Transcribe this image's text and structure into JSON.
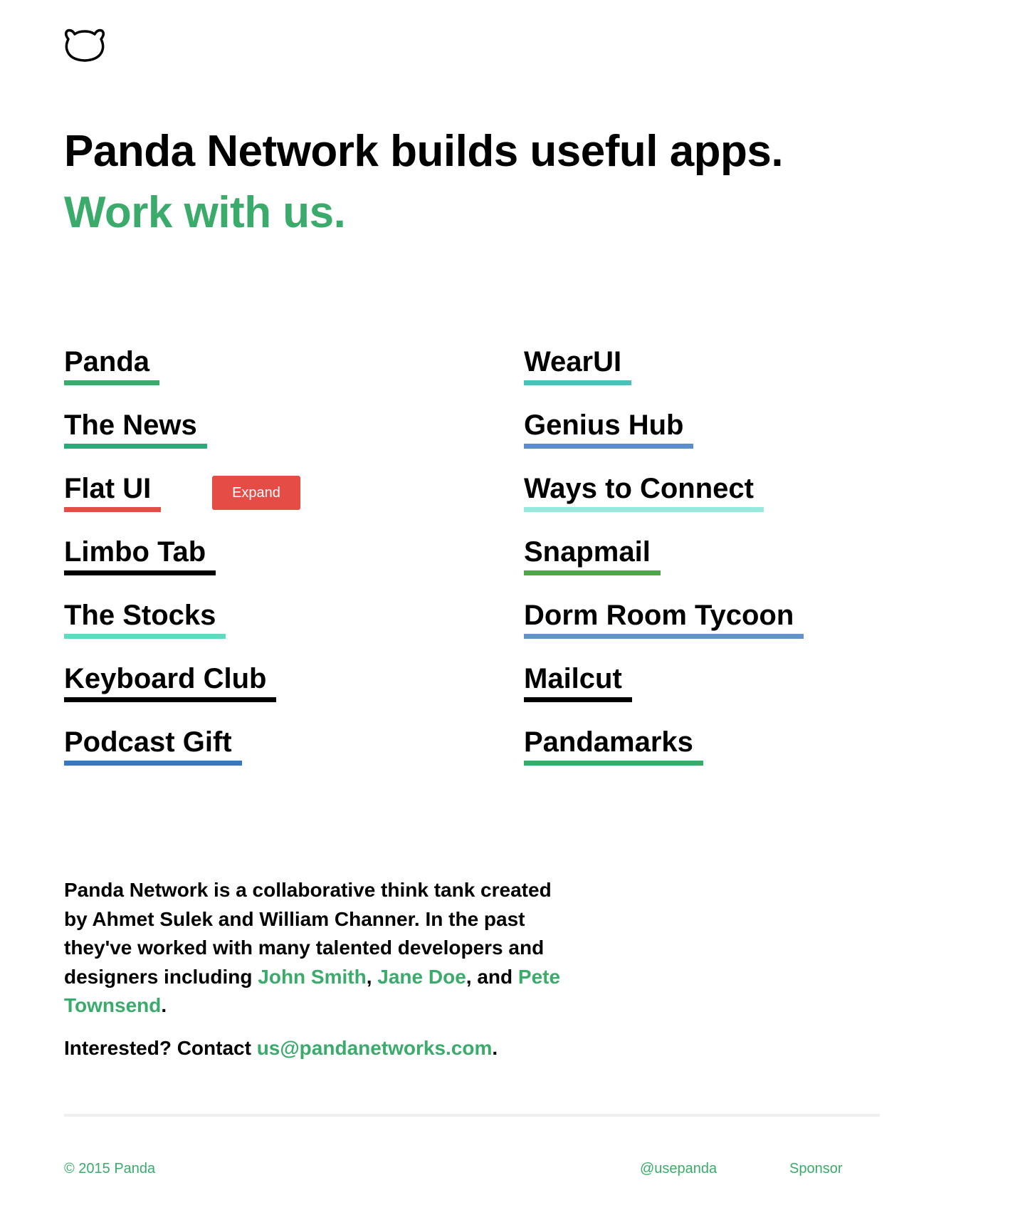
{
  "header": {
    "headline": "Panda Network builds useful apps.",
    "subheadline": "Work with us."
  },
  "projects": {
    "left": [
      {
        "name": "Panda",
        "color": "#3bab6b"
      },
      {
        "name": "The News",
        "color": "#27ab7a"
      },
      {
        "name": "Flat UI",
        "color": "#e44c45"
      },
      {
        "name": "Limbo Tab",
        "color": "#000000"
      },
      {
        "name": "The Stocks",
        "color": "#5ddcc2"
      },
      {
        "name": "Keyboard Club",
        "color": "#000000"
      },
      {
        "name": "Podcast Gift",
        "color": "#3a78be"
      }
    ],
    "right": [
      {
        "name": "WearUI",
        "color": "#4ac0ba"
      },
      {
        "name": "Genius Hub",
        "color": "#5b8ec8"
      },
      {
        "name": "Ways to Connect",
        "color": "#98e9de"
      },
      {
        "name": "Snapmail",
        "color": "#4ea54a"
      },
      {
        "name": "Dorm Room Tycoon",
        "color": "#6092cd"
      },
      {
        "name": "Mailcut",
        "color": "#000000"
      },
      {
        "name": "Pandamarks",
        "color": "#3bab6b"
      }
    ]
  },
  "expand_button": {
    "label": "Expand",
    "color": "#e44c45"
  },
  "about": {
    "text_before": "Panda Network is a collaborative think tank created by Ahmet Sulek and William Channer.  In the past they've worked with many talented developers and designers including ",
    "people": [
      "John Smith",
      "Jane Doe",
      "Pete Townsend"
    ],
    "sep1": ", ",
    "sep2": ", and ",
    "end": "."
  },
  "contact": {
    "prefix": "Interested? Contact ",
    "email": "us@pandanetworks.com",
    "suffix": "."
  },
  "footer": {
    "copyright": "© 2015 Panda",
    "twitter": "@usepanda",
    "sponsor": "Sponsor"
  },
  "colors": {
    "accent": "#3bab6b",
    "text": "#000000",
    "divider": "#efefef"
  }
}
